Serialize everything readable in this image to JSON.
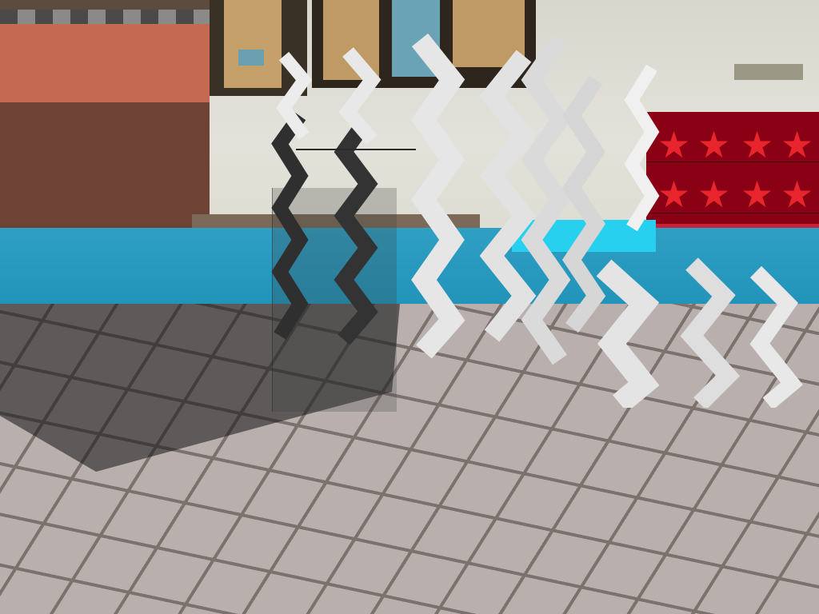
{
  "scene": {
    "type": "voxel-game-first-person-view",
    "colors": {
      "sky": "#d8d7ce",
      "water": "#1d8fb5",
      "floor": "#b9b0ae",
      "grout": "#7c716c",
      "brick": "#c46a52",
      "red_wall": "#8a0014",
      "star": "#e8242c",
      "wave_light": "#e6e6e6",
      "wave_dark": "#2f2f2f"
    }
  }
}
